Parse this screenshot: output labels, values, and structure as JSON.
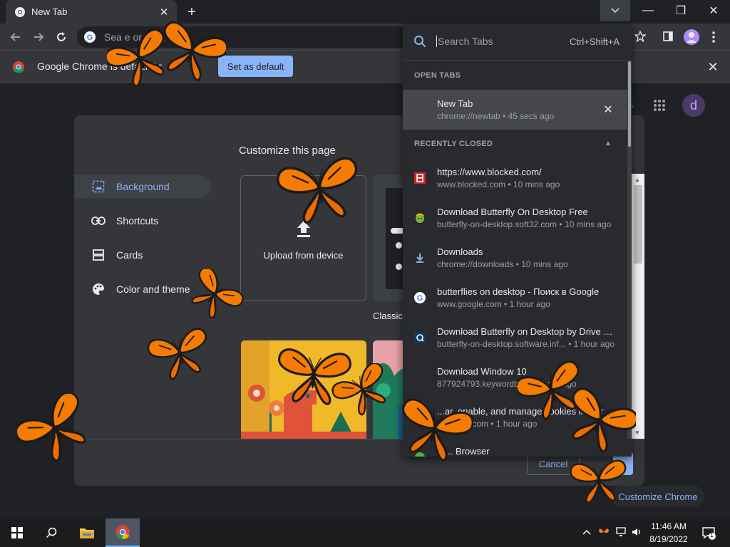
{
  "browser": {
    "tab_title": "New Tab",
    "tab_close": "✕",
    "new_tab": "+",
    "omnibox_text": "Sea          e or    URL",
    "window_controls": {
      "minimize": "—",
      "restore": "❐",
      "close": "✕"
    }
  },
  "infobar": {
    "text": "Google Chrome is     default br",
    "button": "Set as default",
    "close": "✕"
  },
  "ntp": {
    "partial_text": "s",
    "avatar_letter": "d",
    "customize_chrome": "Customize Chrome"
  },
  "dialog": {
    "title": "Customize this page",
    "menu": [
      {
        "label": "Background",
        "icon": "background-icon"
      },
      {
        "label": "Shortcuts",
        "icon": "link-icon"
      },
      {
        "label": "Cards",
        "icon": "cards-icon"
      },
      {
        "label": "Color and theme",
        "icon": "palette-icon"
      }
    ],
    "upload_label": "Upload from device",
    "classic_label": "Classic",
    "cancel": "Cancel"
  },
  "tab_search": {
    "placeholder": "Search Tabs",
    "shortcut": "Ctrl+Shift+A",
    "open_tabs_label": "OPEN TABS",
    "recently_closed_label": "RECENTLY CLOSED",
    "open_tabs": [
      {
        "title": "New Tab",
        "sub": "chrome://newtab • 45 secs ago"
      }
    ],
    "recently_closed": [
      {
        "title": "https://www.blocked.com/",
        "sub": "www.blocked.com • 10 mins ago",
        "icon": "blocked-favicon"
      },
      {
        "title": "Download Butterfly On Desktop Free",
        "sub": "butterfly-on-desktop.soft32.com • 10 mins ago",
        "icon": "soft32-favicon"
      },
      {
        "title": "Downloads",
        "sub": "chrome://downloads • 10 mins ago",
        "icon": "download-icon"
      },
      {
        "title": "butterflies on desktop - Поиск в Google",
        "sub": "www.google.com • 1 hour ago",
        "icon": "google-favicon"
      },
      {
        "title": "Download Butterfly on Desktop by Drive S...",
        "sub": "butterfly-on-desktop.software.inf... • 1 hour ago",
        "icon": "software-informer-favicon"
      },
      {
        "title": "Download Window 10",
        "sub": "877924793.keywordbl... • 1 hour ago",
        "icon": "keyword-favicon"
      },
      {
        "title": "...ar, enable, and manage cookies in Chr",
        "sub": "...google.com • 1 hour ago",
        "icon": "google-favicon"
      },
      {
        "title": "W... Browser",
        "sub": "",
        "icon": "browser-favicon"
      }
    ]
  },
  "taskbar": {
    "time": "11:46 AM",
    "date": "8/19/2022",
    "notification_count": "1"
  }
}
